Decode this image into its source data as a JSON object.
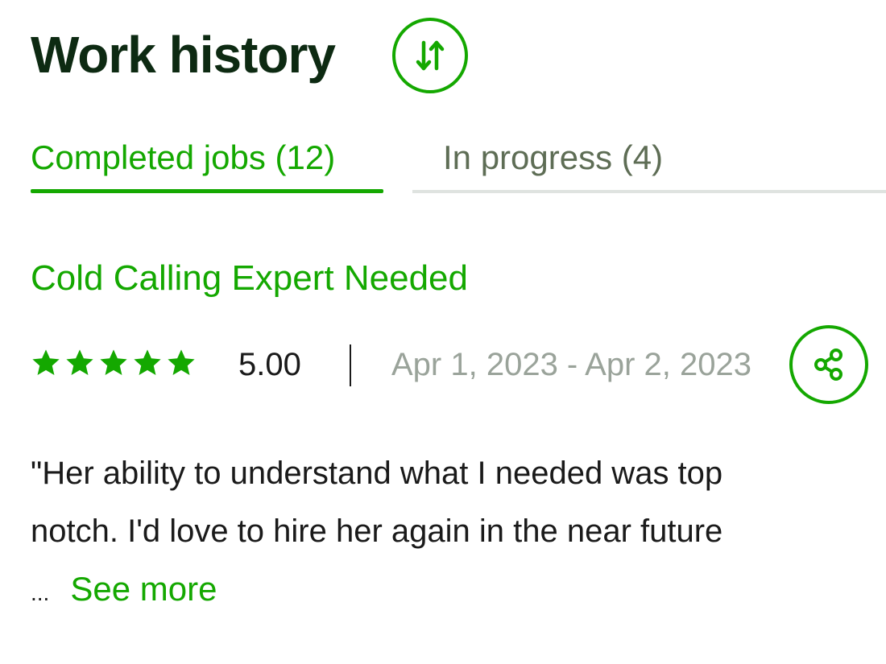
{
  "header": {
    "title": "Work history",
    "sort_icon": "sort-arrows-icon"
  },
  "tabs": [
    {
      "label": "Completed jobs (12)",
      "active": true
    },
    {
      "label": "In progress (4)",
      "active": false
    }
  ],
  "job": {
    "title": "Cold Calling Expert Needed",
    "rating": {
      "stars": 5,
      "max_stars": 5,
      "score": "5.00"
    },
    "dates": "Apr 1, 2023 - Apr 2, 2023",
    "share_icon": "share-icon",
    "review_lines": [
      "\"Her ability to understand what I needed was top",
      "notch. I'd love to hire her again in the near future"
    ],
    "ellipsis": "...",
    "see_more": "See more"
  },
  "colors": {
    "accent": "#14a800",
    "title": "#0d2a12",
    "muted": "#9aa39a",
    "inactive_tab": "#5e6d55"
  }
}
